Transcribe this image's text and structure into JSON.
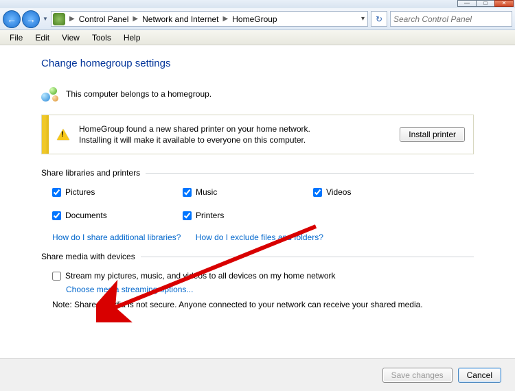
{
  "window": {
    "minimize": "—",
    "maximize": "□",
    "close": "✕"
  },
  "nav": {
    "back": "←",
    "forward": "→",
    "refresh": "↻"
  },
  "breadcrumb": {
    "root": "Control Panel",
    "mid": "Network and Internet",
    "leaf": "HomeGroup"
  },
  "search": {
    "placeholder": "Search Control Panel"
  },
  "menu": {
    "file": "File",
    "edit": "Edit",
    "view": "View",
    "tools": "Tools",
    "help": "Help"
  },
  "page": {
    "title": "Change homegroup settings",
    "belongs": "This computer belongs to a homegroup."
  },
  "notif": {
    "line1": "HomeGroup found a new shared printer on your home network.",
    "line2": "Installing it will make it available to everyone on this computer.",
    "button": "Install printer"
  },
  "sections": {
    "share_libs": "Share libraries and printers",
    "share_media": "Share media with devices"
  },
  "checkboxes": {
    "pictures": {
      "label": "Pictures",
      "checked": true
    },
    "music": {
      "label": "Music",
      "checked": true
    },
    "videos": {
      "label": "Videos",
      "checked": true
    },
    "documents": {
      "label": "Documents",
      "checked": true
    },
    "printers": {
      "label": "Printers",
      "checked": true
    }
  },
  "links": {
    "more_libs": "How do I share additional libraries?",
    "exclude": "How do I exclude files and folders?",
    "stream_options": "Choose media streaming options..."
  },
  "stream": {
    "label": "Stream my pictures, music, and videos to all devices on my home network",
    "checked": false
  },
  "note": "Note: Shared media is not secure. Anyone connected to your network can receive your shared media.",
  "buttons": {
    "save": "Save changes",
    "cancel": "Cancel"
  }
}
